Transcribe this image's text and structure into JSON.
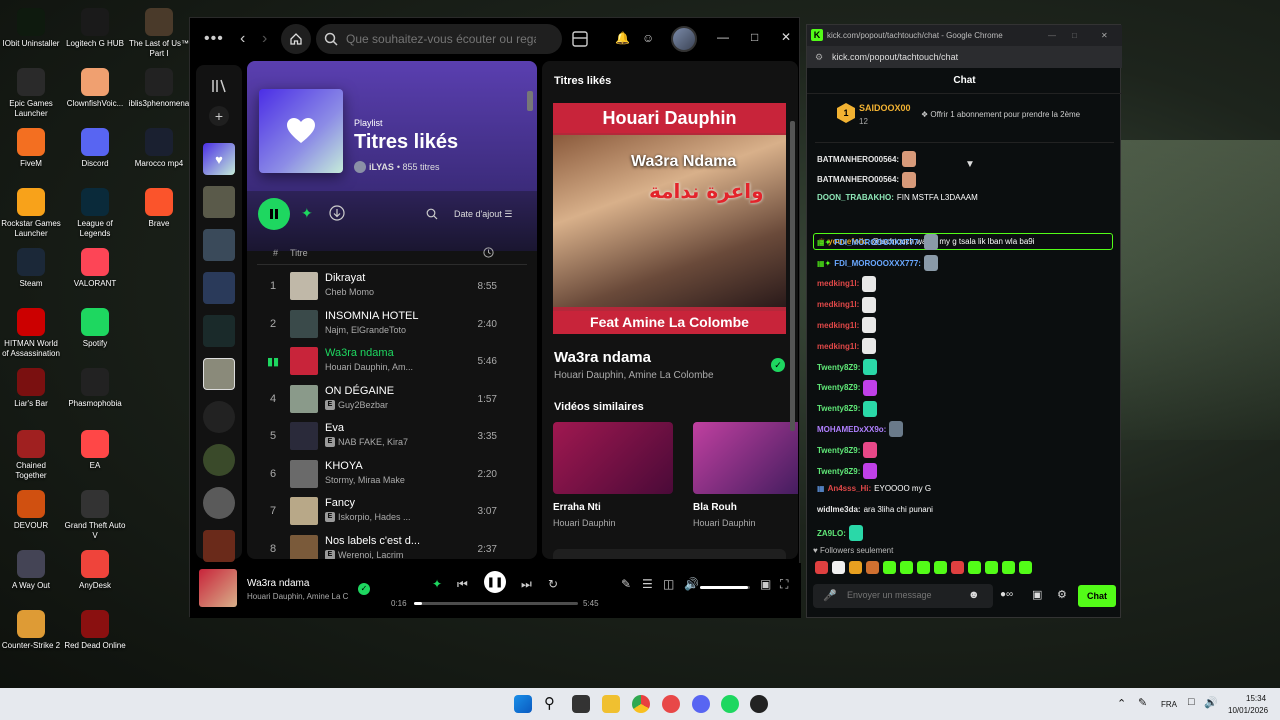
{
  "desktop": {
    "icons": [
      {
        "label": "IObit Uninstaller",
        "color": "#0e1a0e"
      },
      {
        "label": "Logitech G HUB",
        "color": "#1a1a1a"
      },
      {
        "label": "The Last of Us™ Part I",
        "color": "#4a3a2a"
      },
      {
        "label": "Epic Games Launcher",
        "color": "#2a2a2a"
      },
      {
        "label": "ClownfishVoic...",
        "color": "#f0a070"
      },
      {
        "label": "iblis3phenomena",
        "color": "#222"
      },
      {
        "label": "FiveM",
        "color": "#f36f21"
      },
      {
        "label": "Discord",
        "color": "#5865f2"
      },
      {
        "label": "Marocco mp4",
        "color": "#1a2030"
      },
      {
        "label": "Rockstar Games Launcher",
        "color": "#f8a21a"
      },
      {
        "label": "League of Legends",
        "color": "#0a2a3a"
      },
      {
        "label": "Brave",
        "color": "#fb542b"
      },
      {
        "label": "Steam",
        "color": "#1b2838"
      },
      {
        "label": "VALORANT",
        "color": "#fd4556"
      },
      {
        "label": "HITMAN World of Assassination",
        "color": "#c00"
      },
      {
        "label": "Spotify",
        "color": "#1ed760"
      },
      {
        "label": "Liar's Bar",
        "color": "#7a1010"
      },
      {
        "label": "Phasmophobia",
        "color": "#222"
      },
      {
        "label": "Chained Together",
        "color": "#a02020"
      },
      {
        "label": "EA",
        "color": "#ff4747"
      },
      {
        "label": "DEVOUR",
        "color": "#d05010"
      },
      {
        "label": "Grand Theft Auto V",
        "color": "#333"
      },
      {
        "label": "A Way Out",
        "color": "#445"
      },
      {
        "label": "AnyDesk",
        "color": "#ef443b"
      },
      {
        "label": "Counter-Strike 2",
        "color": "#de9b35"
      },
      {
        "label": "Red Dead Online",
        "color": "#8a1010"
      }
    ]
  },
  "spotify": {
    "search_placeholder": "Que souhaitez-vous écouter ou regar...",
    "playlist": {
      "type": "Playlist",
      "title": "Titres likés",
      "owner": "iLYAS",
      "count": "• 855 titres",
      "sort": "Date d'ajout"
    },
    "columns": {
      "num": "#",
      "title": "Titre"
    },
    "tracks": [
      {
        "num": "1",
        "title": "Dikrayat",
        "artist": "Cheb Momo",
        "explicit": false,
        "duration": "8:55",
        "color": "#c0b8a8"
      },
      {
        "num": "2",
        "title": "INSOMNIA HOTEL",
        "artist": "Najm, ElGrandeToto",
        "explicit": false,
        "duration": "2:40",
        "color": "#3a4a4a"
      },
      {
        "num": "",
        "title": "Wa3ra ndama",
        "artist": "Houari Dauphin, Am...",
        "explicit": false,
        "duration": "5:46",
        "color": "#c8243a"
      },
      {
        "num": "4",
        "title": "ON DÉGAINE",
        "artist": "Guy2Bezbar",
        "explicit": true,
        "duration": "1:57",
        "color": "#8a9a8a"
      },
      {
        "num": "5",
        "title": "Eva",
        "artist": "NAB FAKE, Kira7",
        "explicit": true,
        "duration": "3:35",
        "color": "#2a2a3a"
      },
      {
        "num": "6",
        "title": "KHOYA",
        "artist": "Stormy, Miraa Make",
        "explicit": false,
        "duration": "2:20",
        "color": "#6a6a6a"
      },
      {
        "num": "7",
        "title": "Fancy",
        "artist": "Iskorpio, Hades ...",
        "explicit": true,
        "duration": "3:07",
        "color": "#b8a888"
      },
      {
        "num": "8",
        "title": "Nos labels c'est d...",
        "artist": "Werenoi, Lacrim",
        "explicit": true,
        "duration": "2:37",
        "color": "#7a5a3a"
      }
    ],
    "now_playing_panel": {
      "label": "Titres likés",
      "cover_top": "Houari Dauphin",
      "cover_song": "Wa3ra Ndama",
      "cover_arabic": "واعرة ندامة",
      "cover_bottom": "Feat Amine La Colombe",
      "title": "Wa3ra ndama",
      "artist": "Houari Dauphin, Amine La Colombe",
      "similar_label": "Vidéos similaires",
      "videos": [
        {
          "title": "Erraha Nti",
          "artist": "Houari Dauphin"
        },
        {
          "title": "Bla Rouh",
          "artist": "Houari Dauphin"
        }
      ]
    },
    "player": {
      "song": "Wa3ra ndama",
      "artist": "Houari Dauphin, Amine La C",
      "elapsed": "0:16",
      "total": "5:45",
      "progress": 0.046,
      "volume": 0.95
    }
  },
  "chrome": {
    "title": "kick.com/popout/tachtouch/chat - Google Chrome",
    "url": "kick.com/popout/tachtouch/chat",
    "chat_header": "Chat",
    "pinned": {
      "name": "SAIDOOX00",
      "count": "12",
      "level": "1",
      "offer": "Offrir 1 abonnement pour prendre la 2ème"
    },
    "messages": [
      {
        "user": "BATMANHERO00564:",
        "text": "",
        "color": "#e8e8e8",
        "emote": "#d89a7a"
      },
      {
        "user": "BATMANHERO00564:",
        "text": "",
        "color": "#e8e8e8",
        "emote": "#d89a7a"
      },
      {
        "user": "DOON_TRABAKHO:",
        "text": "FIN MSTFA L3DAAAM",
        "color": "#8fe8b8",
        "emote": ""
      },
      {
        "user": "youvefolk:",
        "text": "@tachtouch wax a my g tsala lik lban wla ba9i",
        "color": "#e0a020",
        "emote": ""
      },
      {
        "user": "FDI_MOROOOXXX777:",
        "text": "",
        "color": "#6aa8ff",
        "emote": "#8a9aa8"
      },
      {
        "user": "FDI_MOROOOXXX777:",
        "text": "",
        "color": "#6aa8ff",
        "emote": "#8a9aa8"
      },
      {
        "user": "medking1l:",
        "text": "",
        "color": "#e04848",
        "emote": "#e8e8e8"
      },
      {
        "user": "medking1l:",
        "text": "",
        "color": "#e04848",
        "emote": "#e8e8e8"
      },
      {
        "user": "medking1l:",
        "text": "",
        "color": "#e04848",
        "emote": "#e8e8e8"
      },
      {
        "user": "medking1l:",
        "text": "",
        "color": "#e04848",
        "emote": "#e8e8e8"
      },
      {
        "user": "Twenty8Z9:",
        "text": "",
        "color": "#60e878",
        "emote": "#2ad8a8"
      },
      {
        "user": "Twenty8Z9:",
        "text": "",
        "color": "#60e878",
        "emote": "#c040e8"
      },
      {
        "user": "Twenty8Z9:",
        "text": "",
        "color": "#60e878",
        "emote": "#2ad8a8"
      },
      {
        "user": "MOHAMEDxXX9o:",
        "text": "",
        "color": "#b080ff",
        "emote": "#6a7a8a"
      },
      {
        "user": "Twenty8Z9:",
        "text": "",
        "color": "#60e878",
        "emote": "#e84888"
      },
      {
        "user": "Twenty8Z9:",
        "text": "",
        "color": "#60e878",
        "emote": "#c040e8"
      },
      {
        "user": "An4sss_Hi:",
        "text": "EYOOOO my G",
        "color": "#e04848",
        "emote": ""
      },
      {
        "user": "widlme3da:",
        "text": "ara 3liha chi punani",
        "color": "#e8e8e8",
        "emote": ""
      },
      {
        "user": "ZA9LO:",
        "text": "",
        "color": "#60e878",
        "emote": "#2ad8a8"
      }
    ],
    "followers_only": "Followers seulement",
    "input_placeholder": "Envoyer un message",
    "send_label": "Chat"
  },
  "taskbar": {
    "lang": "FRA",
    "time": "15:34",
    "date": "10/01/2026"
  }
}
